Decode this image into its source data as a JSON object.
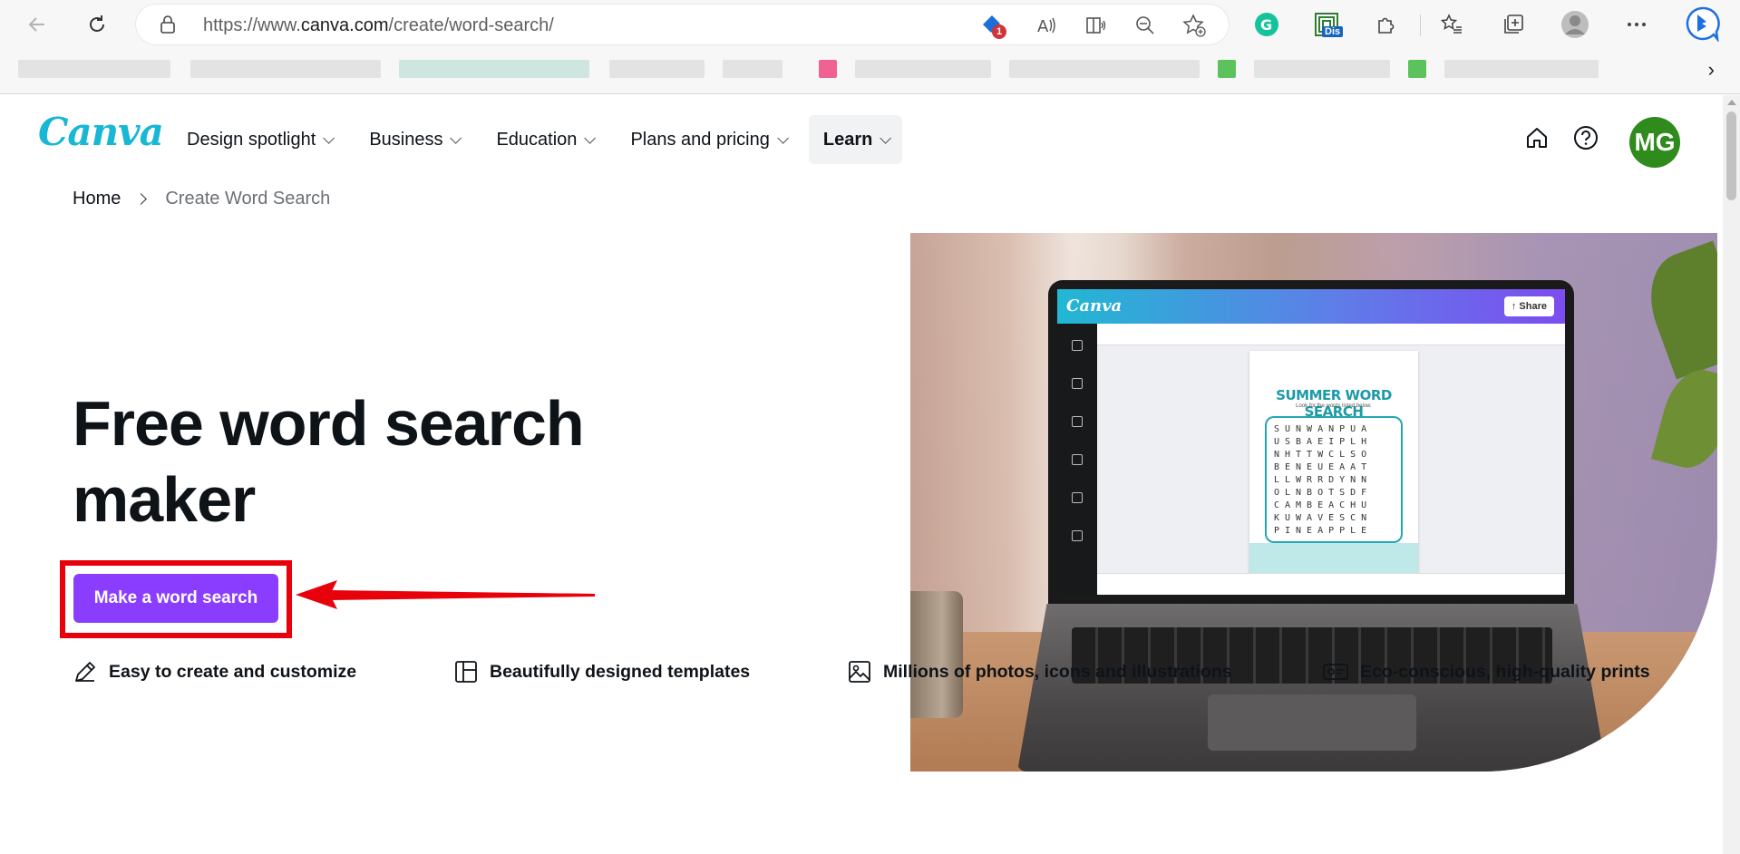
{
  "browser": {
    "url_prefix": "https://www.",
    "url_host": "canva.com",
    "url_path": "/create/word-search/",
    "notification_count": "1",
    "ext_dis_label": "Dis"
  },
  "header": {
    "logo_text": "Canva",
    "nav": [
      {
        "label": "Design spotlight"
      },
      {
        "label": "Business"
      },
      {
        "label": "Education"
      },
      {
        "label": "Plans and pricing"
      },
      {
        "label": "Learn"
      }
    ],
    "avatar_initials": "MG"
  },
  "breadcrumb": {
    "home": "Home",
    "current": "Create Word Search"
  },
  "hero": {
    "title": "Free word search maker",
    "cta_label": "Make a word search"
  },
  "hero_image": {
    "app_logo": "Canva",
    "share_label": "Share",
    "worksheet_title": "SUMMER WORD SEARCH",
    "worksheet_subtitle": "Look for the words listed below.",
    "grid_rows": "SUNWANPUA\nUSBAEIPLH\nNHTTWCLSO\nBENEUEAAT\nLLWRRDYNN\nOLNBOTSDF\nCAMBEACHU\nKUWAVESCN\nPINEAPPLE"
  },
  "features": [
    {
      "label": "Easy to create and customize",
      "icon": "pencil-icon"
    },
    {
      "label": "Beautifully designed templates",
      "icon": "template-icon"
    },
    {
      "label": "Millions of photos, icons and illustrations",
      "icon": "image-icon"
    },
    {
      "label": "Eco-conscious, high-quality prints",
      "icon": "print-icon"
    }
  ],
  "colors": {
    "brand_purple": "#8b3dff",
    "brand_teal": "#18b7d6",
    "highlight_red": "#e8000b",
    "avatar_green": "#2e8b1c"
  }
}
